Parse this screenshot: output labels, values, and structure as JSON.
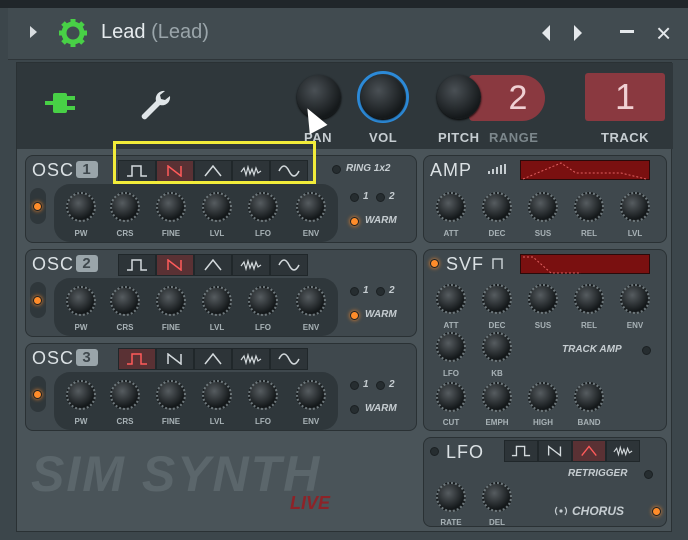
{
  "window": {
    "title": "Lead",
    "title_sub": "(Lead)"
  },
  "top": {
    "pan_label": "PAN",
    "vol_label": "VOL",
    "pitch_label": "PITCH",
    "range_label": "RANGE",
    "range_value": "2",
    "track_label": "TRACK",
    "track_value": "1"
  },
  "osc": [
    {
      "num": "1",
      "label": "OSC",
      "selected_wave": 1
    },
    {
      "num": "2",
      "label": "OSC",
      "selected_wave": 1
    },
    {
      "num": "3",
      "label": "OSC",
      "selected_wave": 0
    }
  ],
  "osc_knobs": [
    "PW",
    "CRS",
    "FINE",
    "LVL",
    "LFO",
    "ENV"
  ],
  "osc_opts": {
    "one": "1",
    "two": "2",
    "warm": "WARM"
  },
  "ring": "RING 1x2",
  "amp": {
    "label": "AMP",
    "knobs": [
      "ATT",
      "DEC",
      "SUS",
      "REL",
      "LVL"
    ]
  },
  "svf": {
    "label": "SVF",
    "knobs_row1": [
      "ATT",
      "DEC",
      "SUS",
      "REL",
      "ENV"
    ],
    "knobs_row2": [
      "LFO",
      "KB"
    ],
    "track_amp": "TRACK AMP",
    "knobs_row3": [
      "CUT",
      "EMPH",
      "HIGH",
      "BAND"
    ]
  },
  "lfo": {
    "label": "LFO",
    "retrigger": "RETRIGGER",
    "knobs": [
      "RATE",
      "DEL"
    ],
    "chorus": "CHORUS"
  },
  "logo": {
    "sim": "SIM",
    "synth": "SYNTH",
    "live": "LIVE"
  },
  "colors": {
    "accent_orange": "#ff8c2a",
    "vol_ring": "#2c8ad8",
    "highlight": "#f2ec3a",
    "display_red": "#8a3940"
  }
}
